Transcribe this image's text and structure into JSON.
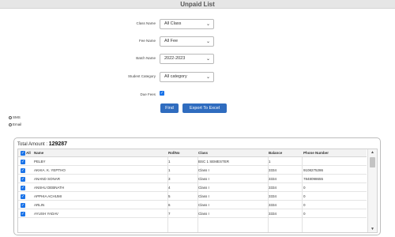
{
  "window": {
    "title": "Unpaid List"
  },
  "filters": {
    "class": {
      "label": "Class Name",
      "value": "All Class"
    },
    "fee": {
      "label": "Fee Name",
      "value": "All Fee"
    },
    "batch": {
      "label": "Batch Name",
      "value": "2022-2023"
    },
    "category": {
      "label": "Student Category",
      "value": "All category"
    },
    "due_fees": {
      "label": "Due Fees",
      "checked": true
    }
  },
  "buttons": {
    "find": "Find",
    "export": "Export To Excel"
  },
  "radios": {
    "sms": "SMS",
    "email": "Email"
  },
  "summary": {
    "label": "Total Amount :",
    "value": "129287"
  },
  "table": {
    "headers": {
      "all": "All",
      "name": "Name",
      "rollno": "RollNo",
      "class": "Class",
      "balance": "Balance",
      "phone": "Phone Number"
    },
    "rows": [
      {
        "name": "PELBY",
        "rollno": "1",
        "class": "BSC 1 SEMESTER",
        "balance": "1",
        "phone": ""
      },
      {
        "name": "AKHIA. K. YEPTHO",
        "rollno": "1",
        "class": "Class I",
        "balance": "3334",
        "phone": "9108275286"
      },
      {
        "name": "ANAND SONAR",
        "rollno": "3",
        "class": "Class I",
        "balance": "3334",
        "phone": "7848098655"
      },
      {
        "name": "ANSHU DEBNATH",
        "rollno": "4",
        "class": "Class I",
        "balance": "3334",
        "phone": "0"
      },
      {
        "name": "APPHIA ACHUMI",
        "rollno": "5",
        "class": "Class I",
        "balance": "3334",
        "phone": "0"
      },
      {
        "name": "ARLIN",
        "rollno": "6",
        "class": "Class I",
        "balance": "3334",
        "phone": "0"
      },
      {
        "name": "AYUSH YADAV",
        "rollno": "7",
        "class": "Class I",
        "balance": "3334",
        "phone": "0"
      }
    ]
  },
  "icons": {
    "dropdown": "chevron-down-icon",
    "check": "checkmark-icon",
    "scroll_up": "triangle-up-icon",
    "scroll_down": "triangle-down-icon"
  },
  "colors": {
    "button": "#2f6cbf",
    "checkbox": "#1a73e8"
  }
}
